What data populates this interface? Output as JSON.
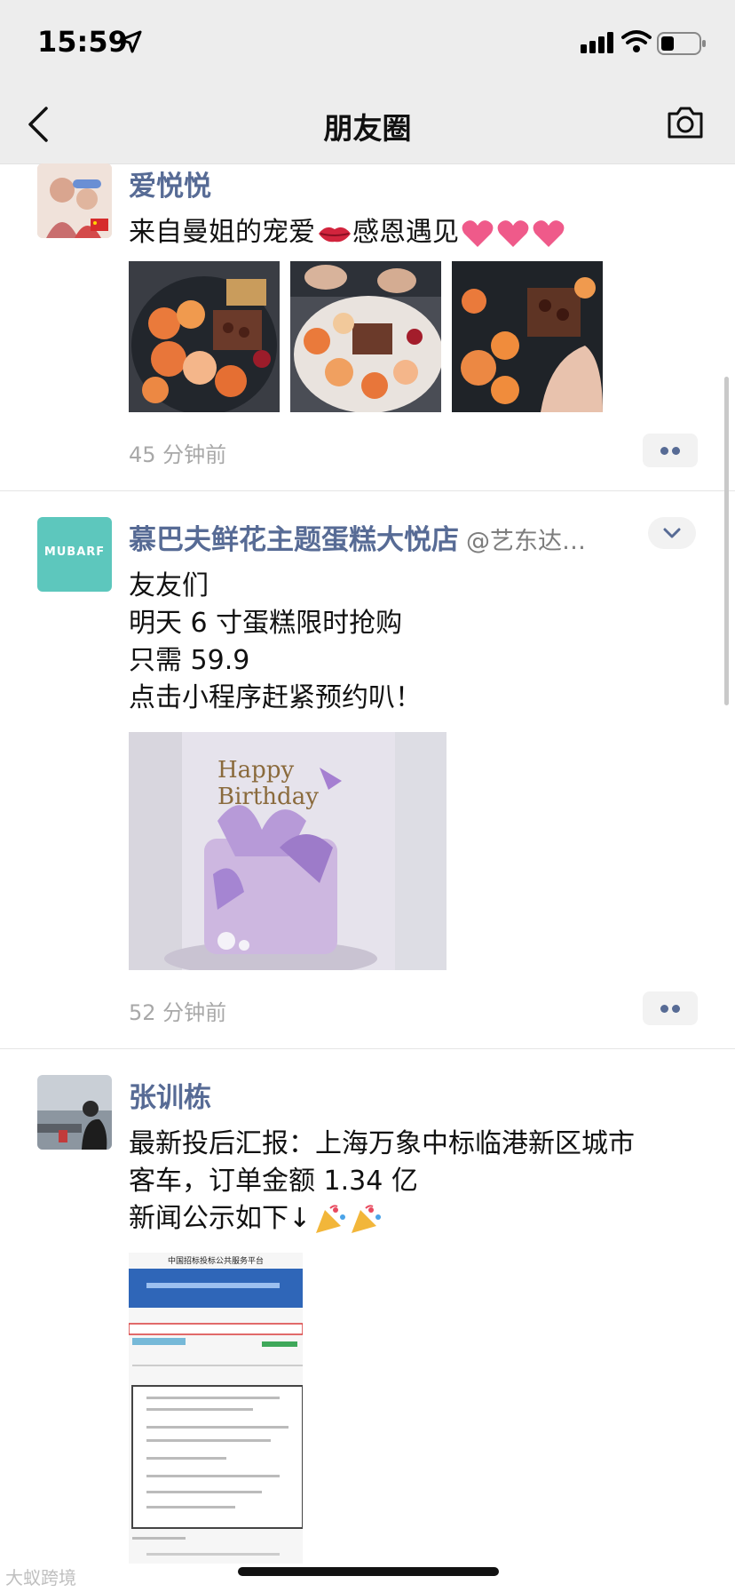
{
  "status_bar": {
    "time": "15:59"
  },
  "nav": {
    "title": "朋友圈"
  },
  "posts": [
    {
      "name": "爱悦悦",
      "lines": [
        "来自曼姐的宠爱",
        "感恩遇见"
      ],
      "timestamp": "45 分钟前",
      "images": [
        "bouquet-photo",
        "bouquet-photo",
        "bouquet-photo"
      ]
    },
    {
      "name": "慕巴夫鲜花主题蛋糕大悦店",
      "mention": "@艺东达…",
      "avatar_text": "MUBARF",
      "lines": [
        "友友们",
        "明天 6 寸蛋糕限时抢购",
        "只需 59.9",
        "点击小程序赶紧预约叭！"
      ],
      "timestamp": "52 分钟前",
      "cake_image_text": "Happy Birthday"
    },
    {
      "name": "张训栋",
      "lines": [
        "最新投后汇报：上海万象中标临港新区城市",
        "客车，订单金额 1.34 亿",
        "新闻公示如下↓"
      ],
      "doc_title": "中国招标投标公共服务平台"
    }
  ],
  "watermark": "大蚁跨境",
  "colors": {
    "name_blue": "#576b95",
    "header_bg": "#ededed",
    "avatar_teal": "#5dc7bd"
  }
}
